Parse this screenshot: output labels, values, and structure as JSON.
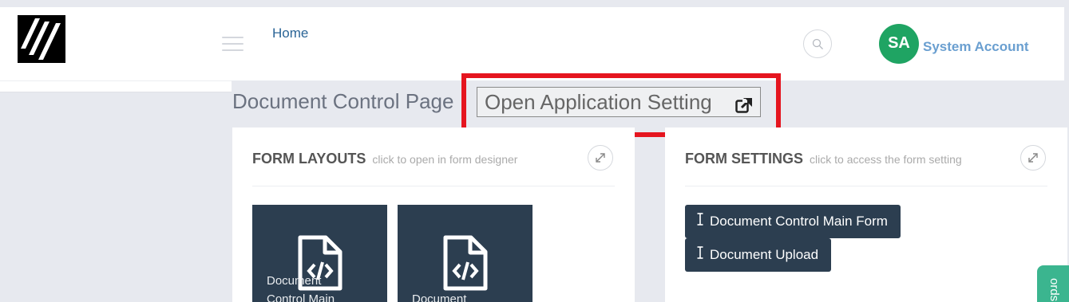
{
  "header": {
    "nav_home": "Home",
    "user_initials": "SA",
    "user_name": "System Account"
  },
  "page": {
    "title": "Document Control Page",
    "app_setting_label": "Open Application Setting"
  },
  "form_layouts": {
    "title": "FORM LAYOUTS",
    "subtitle": "click to open in form designer",
    "tiles": [
      {
        "label": "Document Control Main"
      },
      {
        "label": "Document"
      }
    ]
  },
  "form_settings": {
    "title": "FORM SETTINGS",
    "subtitle": "click to access the form setting",
    "items": [
      {
        "label": "Document Control Main Form"
      },
      {
        "label": "Document Upload"
      }
    ]
  },
  "side_tab": {
    "label": "ords"
  },
  "colors": {
    "accent_green": "#1fa463",
    "tile_dark": "#2c3e50",
    "highlight_red": "#e5151f",
    "link_blue": "#2a6496",
    "side_tab_green": "#3bb58f"
  }
}
